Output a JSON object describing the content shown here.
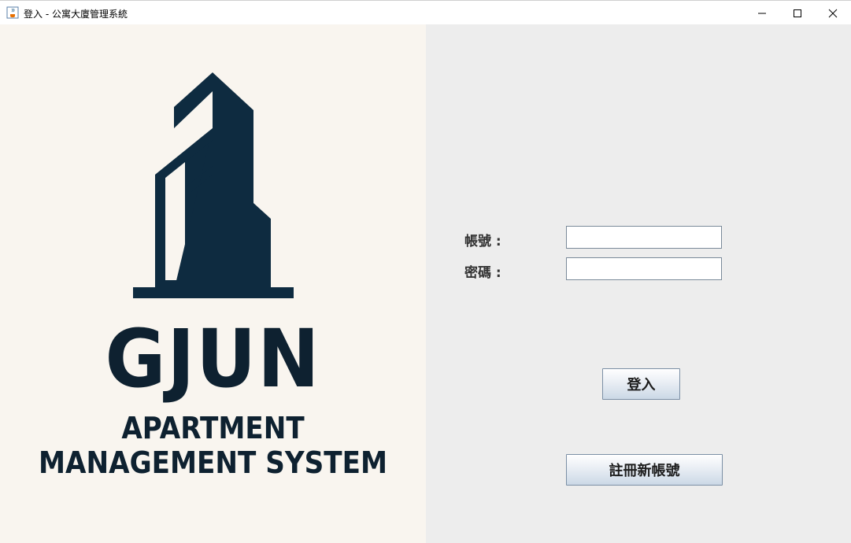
{
  "window": {
    "title": "登入 - 公寓大廈管理系統",
    "app_icon": "java-cup-icon",
    "controls": [
      "minimize-icon",
      "maximize-icon",
      "close-icon"
    ]
  },
  "brand": {
    "logo_icon": "building-icon",
    "main": "GJUN",
    "sub_line1": "APARTMENT",
    "sub_line2": "MANAGEMENT SYSTEM",
    "color": "#0e2130"
  },
  "form": {
    "account_label": "帳號 :",
    "account_value": "",
    "password_label": "密碼 :",
    "password_value": ""
  },
  "buttons": {
    "login_label": "登入",
    "register_label": "註冊新帳號"
  },
  "colors": {
    "left_panel_bg": "#f9f5ef",
    "right_panel_bg": "#ededed"
  }
}
